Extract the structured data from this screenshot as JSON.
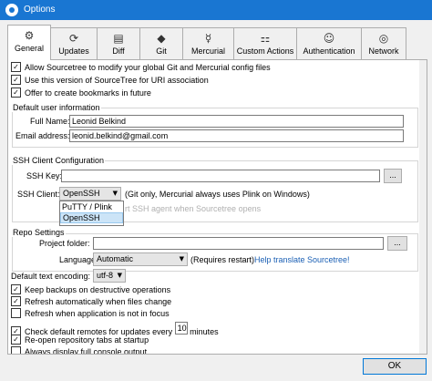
{
  "window": {
    "title": "Options"
  },
  "tabs": [
    {
      "label": "General",
      "icon": "gear-icon",
      "glyph": "⚙"
    },
    {
      "label": "Updates",
      "icon": "refresh-icon",
      "glyph": "⟳"
    },
    {
      "label": "Diff",
      "icon": "diff-icon",
      "glyph": "▤"
    },
    {
      "label": "Git",
      "icon": "git-icon",
      "glyph": "◆"
    },
    {
      "label": "Mercurial",
      "icon": "mercurial-icon",
      "glyph": "☿"
    },
    {
      "label": "Custom Actions",
      "icon": "custom-actions-icon",
      "glyph": "⚏"
    },
    {
      "label": "Authentication",
      "icon": "user-icon",
      "glyph": "☺"
    },
    {
      "label": "Network",
      "icon": "globe-icon",
      "glyph": "◎"
    }
  ],
  "general": {
    "allow_modify_config": "Allow Sourcetree to modify your global Git and Mercurial config files",
    "use_uri": "Use this version of SourceTree for URI association",
    "offer_bookmarks": "Offer to create bookmarks in future"
  },
  "user_info": {
    "title": "Default user information",
    "full_name_label": "Full Name:",
    "full_name_value": "Leonid Belkind",
    "email_label": "Email address:",
    "email_value": "leonid.belkind@gmail.com"
  },
  "ssh": {
    "title": "SSH Client Configuration",
    "key_label": "SSH Key:",
    "browse_label": "...",
    "client_label": "SSH Client:",
    "client_value": "OpenSSH",
    "note": "(Git only, Mercurial always uses Plink on Windows)",
    "agent_text": "rt SSH agent when Sourcetree opens",
    "options": [
      "PuTTY / Plink",
      "OpenSSH"
    ]
  },
  "repo": {
    "title": "Repo Settings",
    "project_label": "Project folder:",
    "browse_label": "...",
    "language_label": "Language:",
    "language_value": "Automatic",
    "restart_note": "(Requires restart)",
    "translate_link": "Help translate Sourcetree!",
    "encoding_label": "Default text encoding:",
    "encoding_value": "utf-8"
  },
  "options": {
    "keep_backups": "Keep backups on destructive operations",
    "refresh_auto": "Refresh automatically when files change",
    "refresh_focus": "Refresh when application is not in focus",
    "check_remotes_pre": "Check default remotes for updates every",
    "check_remotes_value": "10",
    "check_remotes_post": "minutes",
    "reopen_tabs": "Re-open repository tabs at startup",
    "full_console": "Always display full console output"
  },
  "footer": {
    "ok_label": "OK"
  }
}
